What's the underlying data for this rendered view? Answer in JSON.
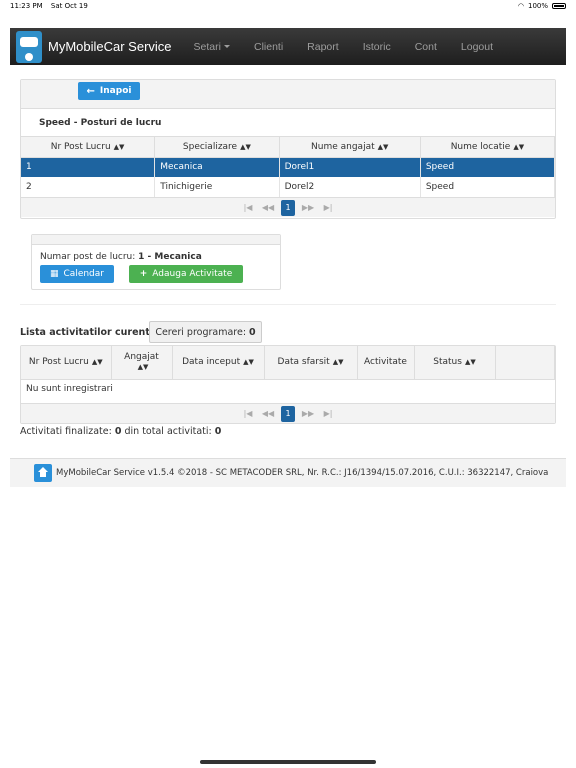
{
  "status": {
    "time": "11:23 PM",
    "date": "Sat Oct 19",
    "battery": "100%"
  },
  "navbar": {
    "brand": "MyMobileCar Service",
    "items": [
      "Setari",
      "Clienti",
      "Raport",
      "Istoric",
      "Cont",
      "Logout"
    ]
  },
  "panel1": {
    "back_label": "Inapoi",
    "title": "Speed - Posturi de lucru",
    "columns": [
      "Nr Post Lucru",
      "Specializare",
      "Nume angajat",
      "Nume locatie"
    ],
    "rows": [
      [
        "1",
        "Mecanica",
        "Dorel1",
        "Speed"
      ],
      [
        "2",
        "Tinichigerie",
        "Dorel2",
        "Speed"
      ]
    ],
    "page": "1"
  },
  "panel2": {
    "label": "Numar post de lucru:",
    "value": "1 - Mecanica",
    "calendar_label": "Calendar",
    "add_label": "Adauga Activitate"
  },
  "activities": {
    "title": "Lista activitatilor curente",
    "requests_label": "Cereri programare:",
    "requests_count": "0",
    "columns": [
      "Nr Post Lucru",
      "Angajat",
      "Data inceput",
      "Data sfarsit",
      "Activitate",
      "Status",
      ""
    ],
    "empty": "Nu sunt inregistrari",
    "page": "1"
  },
  "summary": {
    "finished_label": "Activitati finalizate:",
    "finished": "0",
    "total_label": "din total activitati:",
    "total": "0"
  },
  "footer": {
    "text": "MyMobileCar Service v1.5.4 ©2018  - SC METACODER SRL, Nr. R.C.: J16/1394/15.07.2016, C.U.I.: 36322147, Craiova"
  }
}
